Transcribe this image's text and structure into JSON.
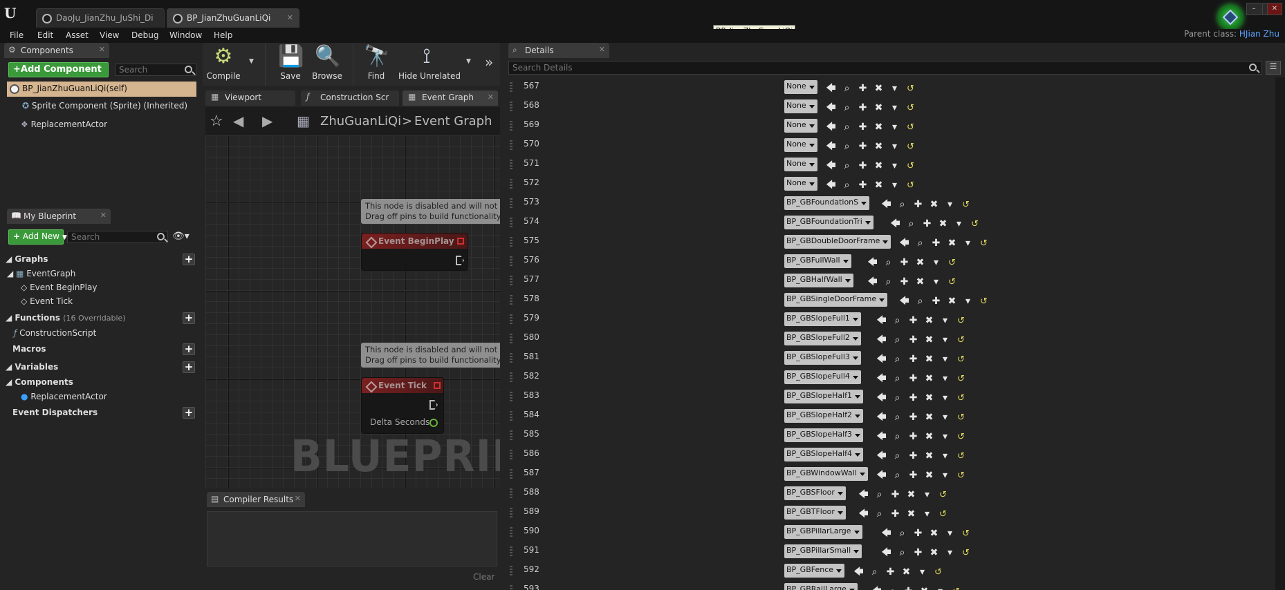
{
  "window": {
    "tabs": [
      {
        "label": "DaoJu_JianZhu_JuShi_Di"
      },
      {
        "label": "BP_JianZhuGuanLiQi"
      }
    ],
    "tooltip": "BP_JianZhuGuanLiQi",
    "parent_class_label": "Parent class:",
    "parent_class_value": "HJian Zhu",
    "minimize": "–",
    "maximize": "□",
    "close": "✕"
  },
  "menu": [
    "File",
    "Edit",
    "Asset",
    "View",
    "Debug",
    "Window",
    "Help"
  ],
  "components": {
    "tab_label": "Components",
    "add_button": "+Add Component",
    "search_placeholder": "Search",
    "root": "BP_JianZhuGuanLiQi(self)",
    "items": [
      "Sprite Component (Sprite) (Inherited)",
      "ReplacementActor"
    ]
  },
  "my_blueprint": {
    "tab_label": "My Blueprint",
    "add_button": "Add New",
    "search_placeholder": "Search",
    "graphs_header": "Graphs",
    "graphs_tree": [
      "EventGraph",
      "Event BeginPlay",
      "Event Tick"
    ],
    "functions_header": "Functions",
    "functions_overridable": "(16 Overridable)",
    "functions": [
      "ConstructionScript"
    ],
    "macros_header": "Macros",
    "variables_header": "Variables",
    "components_header": "Components",
    "components": [
      "ReplacementActor"
    ],
    "dispatchers_header": "Event Dispatchers"
  },
  "toolbar": {
    "compile": "Compile",
    "save": "Save",
    "browse": "Browse",
    "find": "Find",
    "hide_unrelated": "Hide Unrelated"
  },
  "editor_tabs": [
    "Viewport",
    "Construction Scr",
    "Event Graph"
  ],
  "breadcrumb": {
    "asset": "ZhuGuanLiQi",
    "separator": ">",
    "graph": "Event Graph"
  },
  "graph": {
    "comment_line1": "This node is disabled and will not b",
    "comment_line2": "Drag off pins to build functionality.",
    "node_beginplay": "Event BeginPlay",
    "node_tick": "Event Tick",
    "pin_delta": "Delta Seconds",
    "watermark": "BLUEPRINT"
  },
  "compiler": {
    "tab_label": "Compiler Results",
    "clear": "Clear"
  },
  "details": {
    "tab_label": "Details",
    "search_placeholder": "Search Details",
    "rows": [
      {
        "index": "567",
        "value": "None"
      },
      {
        "index": "568",
        "value": "None"
      },
      {
        "index": "569",
        "value": "None"
      },
      {
        "index": "570",
        "value": "None"
      },
      {
        "index": "571",
        "value": "None"
      },
      {
        "index": "572",
        "value": "None"
      },
      {
        "index": "573",
        "value": "BP_GBFoundationS"
      },
      {
        "index": "574",
        "value": "BP_GBFoundationTri"
      },
      {
        "index": "575",
        "value": "BP_GBDoubleDoorFrame"
      },
      {
        "index": "576",
        "value": "BP_GBFullWall"
      },
      {
        "index": "577",
        "value": "BP_GBHalfWall"
      },
      {
        "index": "578",
        "value": "BP_GBSingleDoorFrame"
      },
      {
        "index": "579",
        "value": "BP_GBSlopeFull1"
      },
      {
        "index": "580",
        "value": "BP_GBSlopeFull2"
      },
      {
        "index": "581",
        "value": "BP_GBSlopeFull3"
      },
      {
        "index": "582",
        "value": "BP_GBSlopeFull4"
      },
      {
        "index": "583",
        "value": "BP_GBSlopeHalf1"
      },
      {
        "index": "584",
        "value": "BP_GBSlopeHalf2"
      },
      {
        "index": "585",
        "value": "BP_GBSlopeHalf3"
      },
      {
        "index": "586",
        "value": "BP_GBSlopeHalf4"
      },
      {
        "index": "587",
        "value": "BP_GBWindowWall"
      },
      {
        "index": "588",
        "value": "BP_GBSFloor"
      },
      {
        "index": "589",
        "value": "BP_GBTFloor"
      },
      {
        "index": "590",
        "value": "BP_GBPillarLarge"
      },
      {
        "index": "591",
        "value": "BP_GBPillarSmall"
      },
      {
        "index": "592",
        "value": "BP_GBFence"
      },
      {
        "index": "593",
        "value": "BP_GBRailLarge"
      }
    ]
  }
}
